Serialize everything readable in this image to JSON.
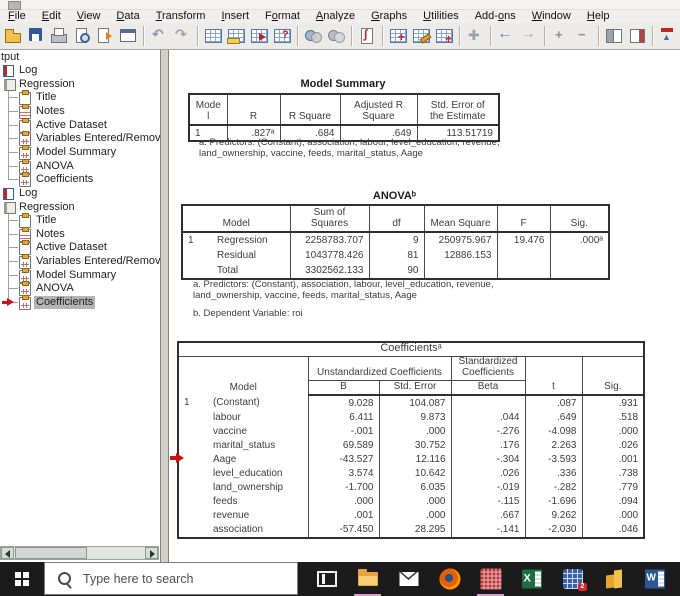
{
  "menubar": {
    "items": [
      {
        "label": "File",
        "accel": 0
      },
      {
        "label": "Edit",
        "accel": 0
      },
      {
        "label": "View",
        "accel": 0
      },
      {
        "label": "Data",
        "accel": 0
      },
      {
        "label": "Transform",
        "accel": 0
      },
      {
        "label": "Insert",
        "accel": 0
      },
      {
        "label": "Format",
        "accel": 1
      },
      {
        "label": "Analyze",
        "accel": 0
      },
      {
        "label": "Graphs",
        "accel": 0
      },
      {
        "label": "Utilities",
        "accel": 0
      },
      {
        "label": "Add-ons",
        "accel": 4
      },
      {
        "label": "Window",
        "accel": 0
      },
      {
        "label": "Help",
        "accel": 0
      }
    ]
  },
  "toolbar": {
    "icons": [
      "open-output-icon",
      "save-icon",
      "print-icon",
      "print-preview-icon",
      "export-icon",
      "dialog-recall-icon",
      "sep",
      "undo-icon",
      "redo-icon",
      "sep",
      "goto-data-icon",
      "goto-case-icon",
      "goto-variable-icon",
      "variables-info-icon",
      "sep",
      "find-icon",
      "select-cases-icon",
      "sep",
      "run-script-icon",
      "sep",
      "insert-cases-icon",
      "edit-sets-icon",
      "value-labels-icon",
      "sep",
      "select-last-output-icon",
      "sep",
      "back-icon",
      "forward-icon",
      "sep",
      "expand-icon",
      "collapse-icon",
      "sep",
      "show-book-icon",
      "hide-book-icon",
      "sep",
      "insert-heading-icon",
      "insert-title-icon",
      "insert-text-icon"
    ]
  },
  "sidebar": {
    "root_label": "tput",
    "items": [
      {
        "label": "Log",
        "icon": "log-icon",
        "level": 0
      },
      {
        "label": "Regression",
        "icon": "regression-icon",
        "level": 0
      },
      {
        "label": "Title",
        "icon": "title-icon",
        "level": 1
      },
      {
        "label": "Notes",
        "icon": "notes-icon",
        "level": 1
      },
      {
        "label": "Active Dataset",
        "icon": "dataset-icon",
        "level": 1
      },
      {
        "label": "Variables Entered/Removed",
        "icon": "output-table-icon",
        "level": 1
      },
      {
        "label": "Model Summary",
        "icon": "output-table-icon",
        "level": 1
      },
      {
        "label": "ANOVA",
        "icon": "output-table-icon",
        "level": 1
      },
      {
        "label": "Coefficients",
        "icon": "output-table-icon",
        "level": 1
      },
      {
        "label": "Log",
        "icon": "log-icon",
        "level": 0
      },
      {
        "label": "Regression",
        "icon": "regression-icon",
        "level": 0
      },
      {
        "label": "Title",
        "icon": "title-icon",
        "level": 1
      },
      {
        "label": "Notes",
        "icon": "notes-icon",
        "level": 1
      },
      {
        "label": "Active Dataset",
        "icon": "dataset-icon",
        "level": 1
      },
      {
        "label": "Variables Entered/Removed",
        "icon": "output-table-icon",
        "level": 1
      },
      {
        "label": "Model Summary",
        "icon": "output-table-icon",
        "level": 1
      },
      {
        "label": "ANOVA",
        "icon": "output-table-icon",
        "level": 1
      },
      {
        "label": "Coefficients",
        "icon": "output-table-icon",
        "level": 1,
        "selected": true,
        "arrow": true
      }
    ]
  },
  "content": {
    "model_summary": {
      "title": "Model Summary",
      "h_model": [
        "Mode",
        "l"
      ],
      "h_r": "R",
      "h_r2": "R Square",
      "h_adj": [
        "Adjusted R",
        "Square"
      ],
      "h_se": [
        "Std. Error of",
        "the Estimate"
      ],
      "rows": [
        {
          "model": "1",
          "r": ".827ᵃ",
          "r2": ".684",
          "adj": ".649",
          "se": "113.51719"
        }
      ],
      "fn1": "a. Predictors: (Constant), association, labour, level_education, revenue,",
      "fn2": "land_ownership, vaccine, feeds, marital_status, Aage"
    },
    "anova": {
      "title": "ANOVAᵇ",
      "h_model": "Model",
      "h_ss": [
        "Sum of",
        "Squares"
      ],
      "h_df": "df",
      "h_ms": "Mean Square",
      "h_f": "F",
      "h_sig": "Sig.",
      "rows": [
        {
          "m": "1",
          "label": "Regression",
          "ss": "2258783.707",
          "df": "9",
          "ms": "250975.967",
          "f": "19.476",
          "sig": ".000ᵃ"
        },
        {
          "m": "",
          "label": "Residual",
          "ss": "1043778.426",
          "df": "81",
          "ms": "12886.153",
          "f": "",
          "sig": ""
        },
        {
          "m": "",
          "label": "Total",
          "ss": "3302562.133",
          "df": "90",
          "ms": "",
          "f": "",
          "sig": ""
        }
      ],
      "fn1": "a. Predictors: (Constant), association, labour, level_education, revenue,",
      "fn2": "land_ownership, vaccine, feeds, marital_status, Aage",
      "fn3": "b. Dependent Variable: roi"
    },
    "coefficients": {
      "title": "Coefficientsᵃ",
      "h_model": "Model",
      "h_unstd": "Unstandardized Coefficients",
      "h_std": [
        "Standardized",
        "Coefficients"
      ],
      "h_b": "B",
      "h_se": "Std. Error",
      "h_beta": "Beta",
      "h_t": "t",
      "h_sig": "Sig.",
      "rows": [
        {
          "m": "1",
          "label": "(Constant)",
          "b": "9.028",
          "se": "104.087",
          "beta": "",
          "t": ".087",
          "sig": ".931"
        },
        {
          "m": "",
          "label": "labour",
          "b": "6.411",
          "se": "9.873",
          "beta": ".044",
          "t": ".649",
          "sig": ".518"
        },
        {
          "m": "",
          "label": "vaccine",
          "b": "-.001",
          "se": ".000",
          "beta": "-.276",
          "t": "-4.098",
          "sig": ".000"
        },
        {
          "m": "",
          "label": "marital_status",
          "b": "69.589",
          "se": "30.752",
          "beta": ".176",
          "t": "2.263",
          "sig": ".026"
        },
        {
          "m": "",
          "label": "Aage",
          "b": "-43.527",
          "se": "12.116",
          "beta": "-.304",
          "t": "-3.593",
          "sig": ".001"
        },
        {
          "m": "",
          "label": "level_education",
          "b": "3.574",
          "se": "10.642",
          "beta": ".026",
          "t": ".336",
          "sig": ".738"
        },
        {
          "m": "",
          "label": "land_ownership",
          "b": "-1.700",
          "se": "6.035",
          "beta": "-.019",
          "t": "-.282",
          "sig": ".779"
        },
        {
          "m": "",
          "label": "feeds",
          "b": ".000",
          "se": ".000",
          "beta": "-.115",
          "t": "-1.696",
          "sig": ".094"
        },
        {
          "m": "",
          "label": "revenue",
          "b": ".001",
          "se": ".000",
          "beta": ".667",
          "t": "9.262",
          "sig": ".000"
        },
        {
          "m": "",
          "label": "association",
          "b": "-57.450",
          "se": "28.295",
          "beta": "-.141",
          "t": "-2.030",
          "sig": ".046"
        }
      ]
    }
  },
  "taskbar": {
    "search_placeholder": "Type here to search",
    "icons": [
      {
        "name": "task-view-icon",
        "active": false
      },
      {
        "name": "file-explorer-icon",
        "active": true
      },
      {
        "name": "mail-icon",
        "active": false
      },
      {
        "name": "firefox-icon",
        "active": false
      },
      {
        "name": "spss-viewer-icon",
        "active": true
      },
      {
        "name": "excel-icon",
        "active": false
      },
      {
        "name": "spss-data-icon",
        "active": false,
        "badge": "2"
      },
      {
        "name": "powerbi-icon",
        "active": false
      },
      {
        "name": "word-icon",
        "active": false
      }
    ]
  }
}
